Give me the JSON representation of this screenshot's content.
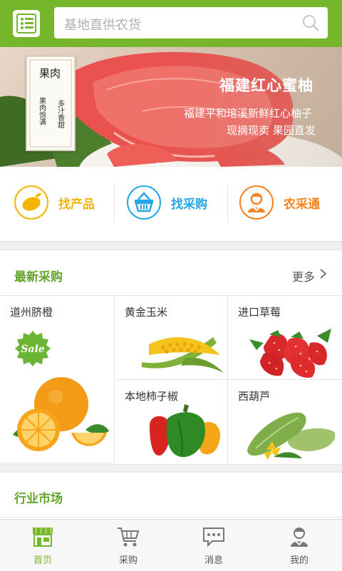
{
  "header": {
    "search_placeholder": "基地直供农货"
  },
  "banner": {
    "title": "福建红心蜜柚",
    "subtitle_line1": "福建平和琯溪新鲜红心柚子",
    "subtitle_line2": "现摘现卖 果园直发",
    "card_title": "果肉",
    "card_line1": "果肉饱满",
    "card_line2": "多汁香甜",
    "dots": 4,
    "active_dot": 1
  },
  "quick_links": [
    {
      "label": "找产品",
      "color": "#f5b400"
    },
    {
      "label": "找采购",
      "color": "#27a5e6"
    },
    {
      "label": "农采通",
      "color": "#f58220"
    }
  ],
  "latest": {
    "title": "最新采购",
    "more": "更多",
    "items": [
      {
        "name": "道州脐橙",
        "badge": "Sale"
      },
      {
        "name": "黄金玉米"
      },
      {
        "name": "进口草莓"
      },
      {
        "name": "本地柿子椒"
      },
      {
        "name": "西葫芦"
      }
    ]
  },
  "industry": {
    "title": "行业市场"
  },
  "bottom_nav": [
    {
      "label": "首页",
      "active": true
    },
    {
      "label": "采购",
      "active": false
    },
    {
      "label": "消息",
      "active": false
    },
    {
      "label": "我的",
      "active": false
    }
  ],
  "colors": {
    "brand_green": "#75b62b",
    "section_title": "#63a52a"
  }
}
